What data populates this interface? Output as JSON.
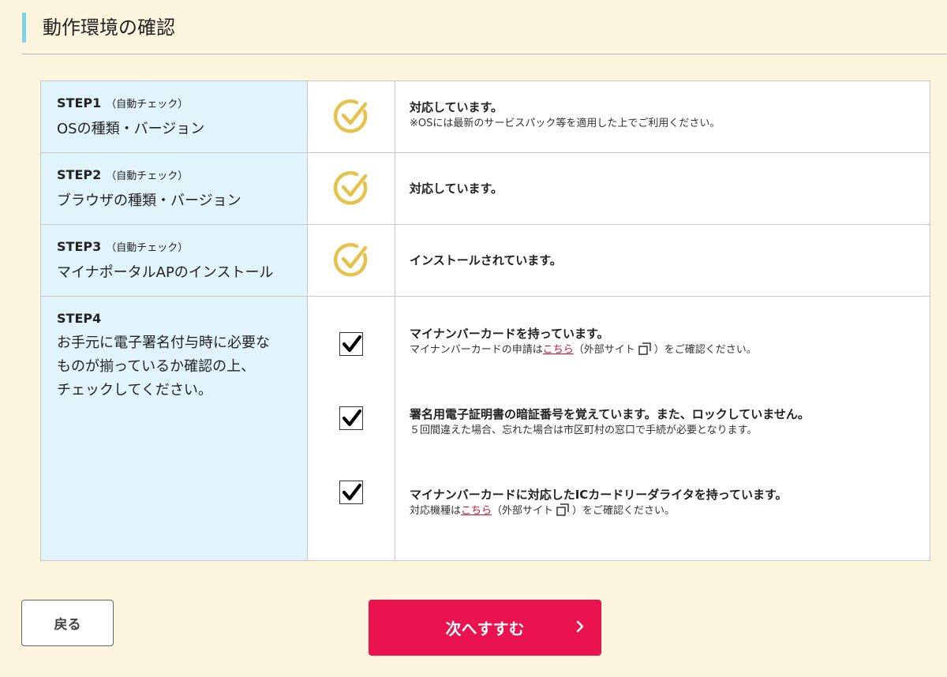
{
  "page": {
    "title": "動作環境の確認"
  },
  "steps": [
    {
      "title": "STEP1",
      "auto": "（自動チェック）",
      "label": "OSの種類・バージョン",
      "status": "対応しています。",
      "note": "※OSには最新のサービスパック等を適用した上でご利用ください。"
    },
    {
      "title": "STEP2",
      "auto": "（自動チェック）",
      "label": "ブラウザの種類・バージョン",
      "status": "対応しています。"
    },
    {
      "title": "STEP3",
      "auto": "（自動チェック）",
      "label": "マイナポータルAPのインストール",
      "status": "インストールされています。"
    }
  ],
  "step4": {
    "title": "STEP4",
    "text_lines": [
      "お手元に電子署名付与時に必要な",
      "ものが揃っているか確認の上、",
      "チェックしてください。"
    ],
    "checks": [
      {
        "checked": true,
        "label": "マイナンバーカードを持っています。",
        "note_pre": "マイナンバーカードの申請は",
        "link": "こちら",
        "note_mid": "（外部サイト",
        "note_post": "）をご確認ください。"
      },
      {
        "checked": true,
        "label": "署名用電子証明書の暗証番号を覚えています。また、ロックしていません。",
        "note": "５回間違えた場合、忘れた場合は市区町村の窓口で手続が必要となります。"
      },
      {
        "checked": true,
        "label": "マイナンバーカードに対応したICカードリーダライタを持っています。",
        "note_pre": "対応機種は",
        "link": "こちら",
        "note_mid": "（外部サイト",
        "note_post": "）をご確認ください。"
      }
    ]
  },
  "buttons": {
    "back": "戻る",
    "next": "次へすすむ"
  },
  "colors": {
    "accent": "#e8134f",
    "ok_icon": "#e6c24a",
    "label_bg": "#e1f4fc",
    "page_bg": "#fdf5dd"
  },
  "icons": {
    "ok": "check-circle-icon",
    "checkbox": "checkmark-icon",
    "external": "external-link-icon",
    "next": "chevron-right-icon"
  }
}
